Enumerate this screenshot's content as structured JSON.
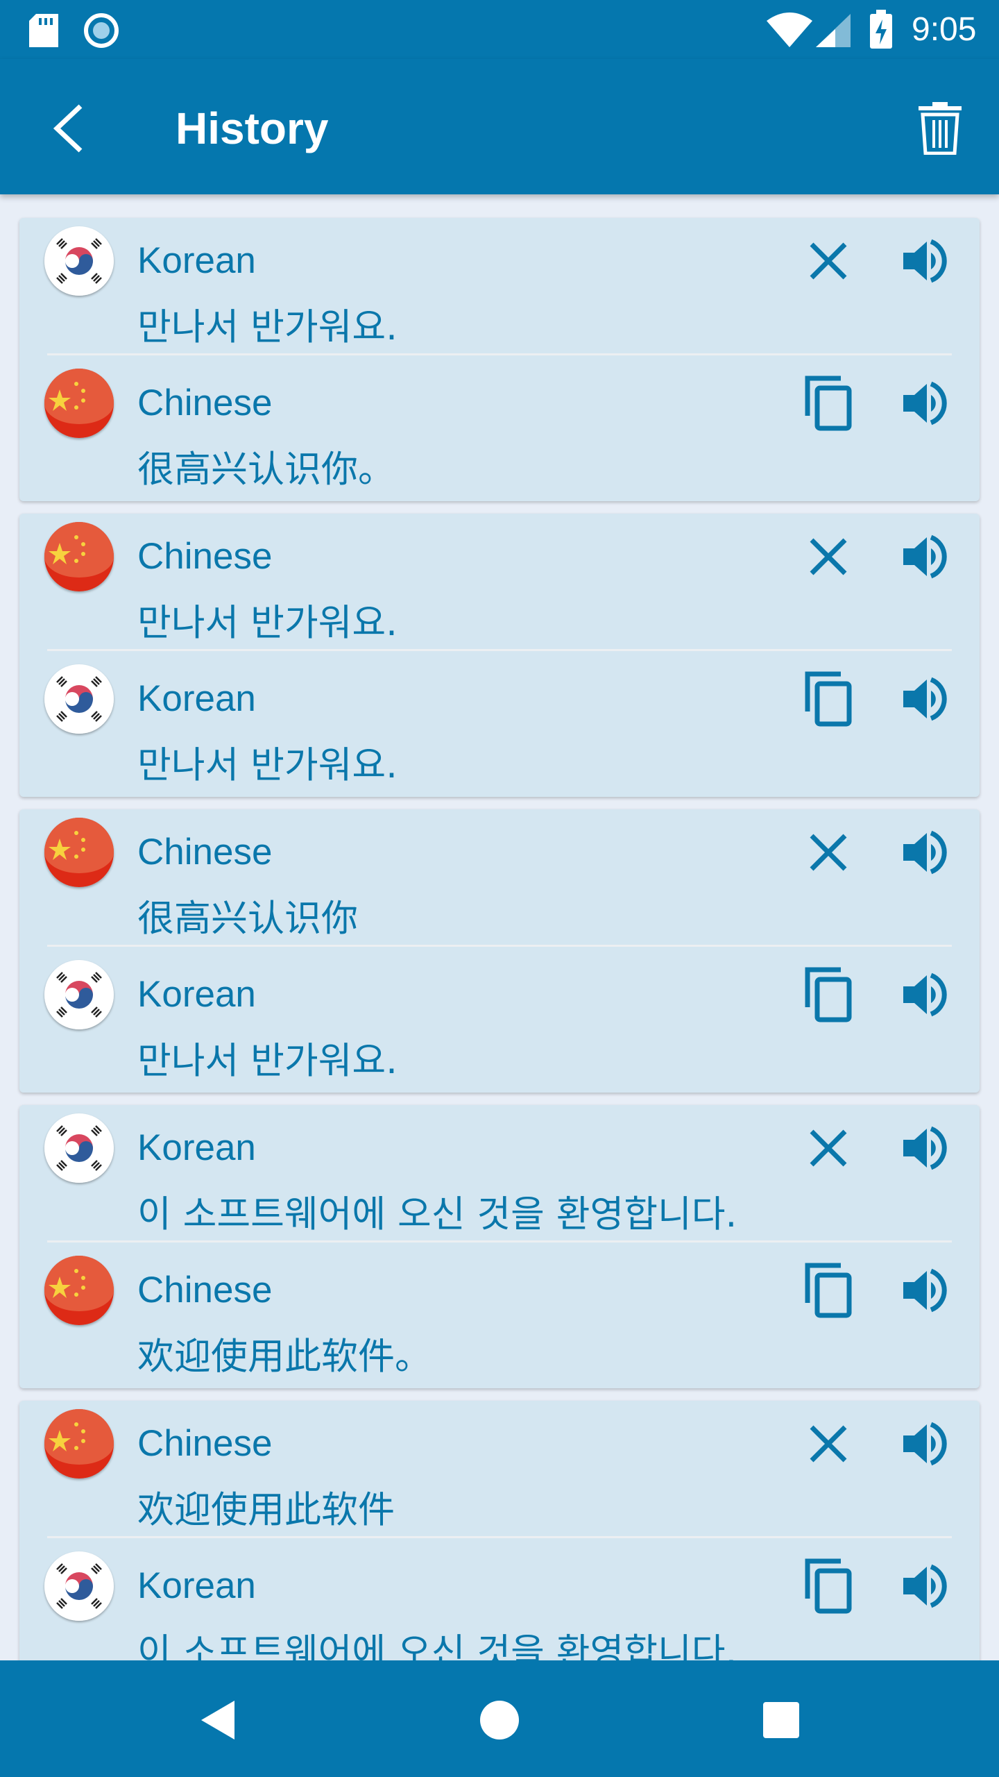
{
  "status_bar": {
    "time": "9:05",
    "icons": [
      "sd-card-icon",
      "circle-notification-icon",
      "wifi-icon",
      "signal-icon",
      "battery-charging-icon"
    ]
  },
  "app_bar": {
    "title": "History",
    "back_icon": "arrow-back-icon",
    "delete_icon": "trash-icon"
  },
  "colors": {
    "primary": "#0577ae",
    "card": "#d4e6f1",
    "text": "#0a77ab",
    "background": "#e8eef7"
  },
  "history": [
    {
      "source": {
        "lang": "Korean",
        "flag": "korea",
        "text": "만나서 반가워요."
      },
      "target": {
        "lang": "Chinese",
        "flag": "china",
        "text": "很高兴认识你。"
      }
    },
    {
      "source": {
        "lang": "Chinese",
        "flag": "china",
        "text": "만나서 반가워요."
      },
      "target": {
        "lang": "Korean",
        "flag": "korea",
        "text": "만나서 반가워요."
      }
    },
    {
      "source": {
        "lang": "Chinese",
        "flag": "china",
        "text": "很高兴认识你"
      },
      "target": {
        "lang": "Korean",
        "flag": "korea",
        "text": "만나서 반가워요."
      }
    },
    {
      "source": {
        "lang": "Korean",
        "flag": "korea",
        "text": "이 소프트웨어에 오신 것을 환영합니다."
      },
      "target": {
        "lang": "Chinese",
        "flag": "china",
        "text": "欢迎使用此软件。"
      }
    },
    {
      "source": {
        "lang": "Chinese",
        "flag": "china",
        "text": "欢迎使用此软件"
      },
      "target": {
        "lang": "Korean",
        "flag": "korea",
        "text": "이 소프트웨어에 오신 것을 환영합니다."
      }
    }
  ],
  "nav_bar": {
    "icons": [
      "back-triangle-icon",
      "home-circle-icon",
      "recents-square-icon"
    ]
  }
}
